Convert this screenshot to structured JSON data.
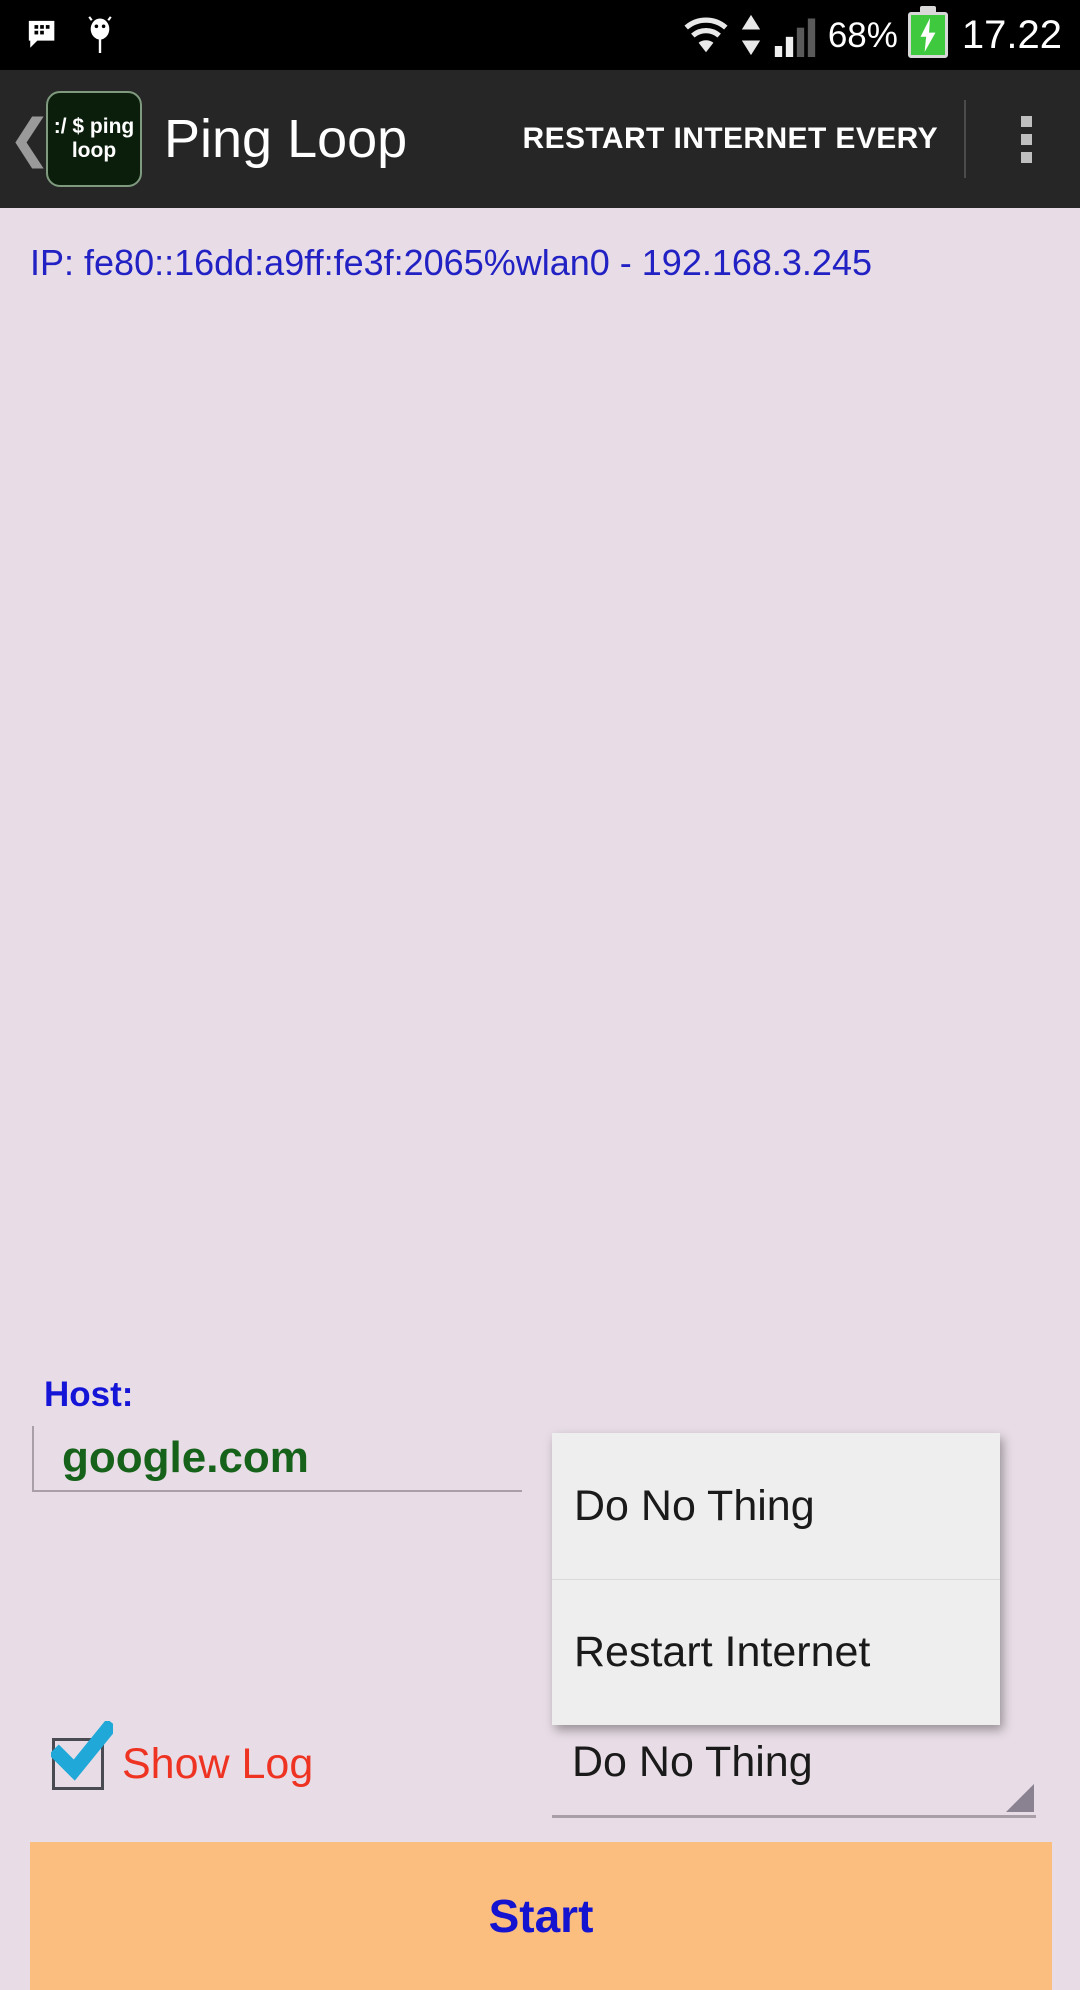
{
  "status_bar": {
    "icons": [
      "message-icon",
      "android-robot-icon",
      "wifi-icon",
      "data-transfer-icon",
      "signal-bars-icon",
      "battery-charging-icon"
    ],
    "battery_percent": "68%",
    "time": "17.22"
  },
  "app_bar": {
    "back_icon": "❮",
    "app_icon_line1": ":/ $ ping",
    "app_icon_line2": "loop",
    "title": "Ping Loop",
    "action_label": "RESTART INTERNET EVERY",
    "overflow_icon": "more-vertical-icon"
  },
  "main": {
    "ip_text": "IP: fe80::16dd:a9ff:fe3f:2065%wlan0 - 192.168.3.245",
    "host_label": "Host:",
    "host_value": "google.com",
    "host_placeholder": "google.com",
    "show_log_label": "Show Log",
    "show_log_checked": true,
    "spinner_value": "Do No Thing",
    "spinner_options": [
      "Do No Thing",
      "Restart Internet"
    ],
    "start_label": "Start"
  },
  "colors": {
    "status_bar_bg": "#000000",
    "app_bar_bg": "#262626",
    "content_bg": "#e8dde6",
    "ip_text": "#2121c4",
    "host_label": "#1515d8",
    "host_value": "#16621a",
    "show_log": "#ee3322",
    "start_bg": "#fbbe7e",
    "start_text": "#1414d0",
    "battery_green": "#3ec93e",
    "popup_bg": "#eeeeee"
  }
}
